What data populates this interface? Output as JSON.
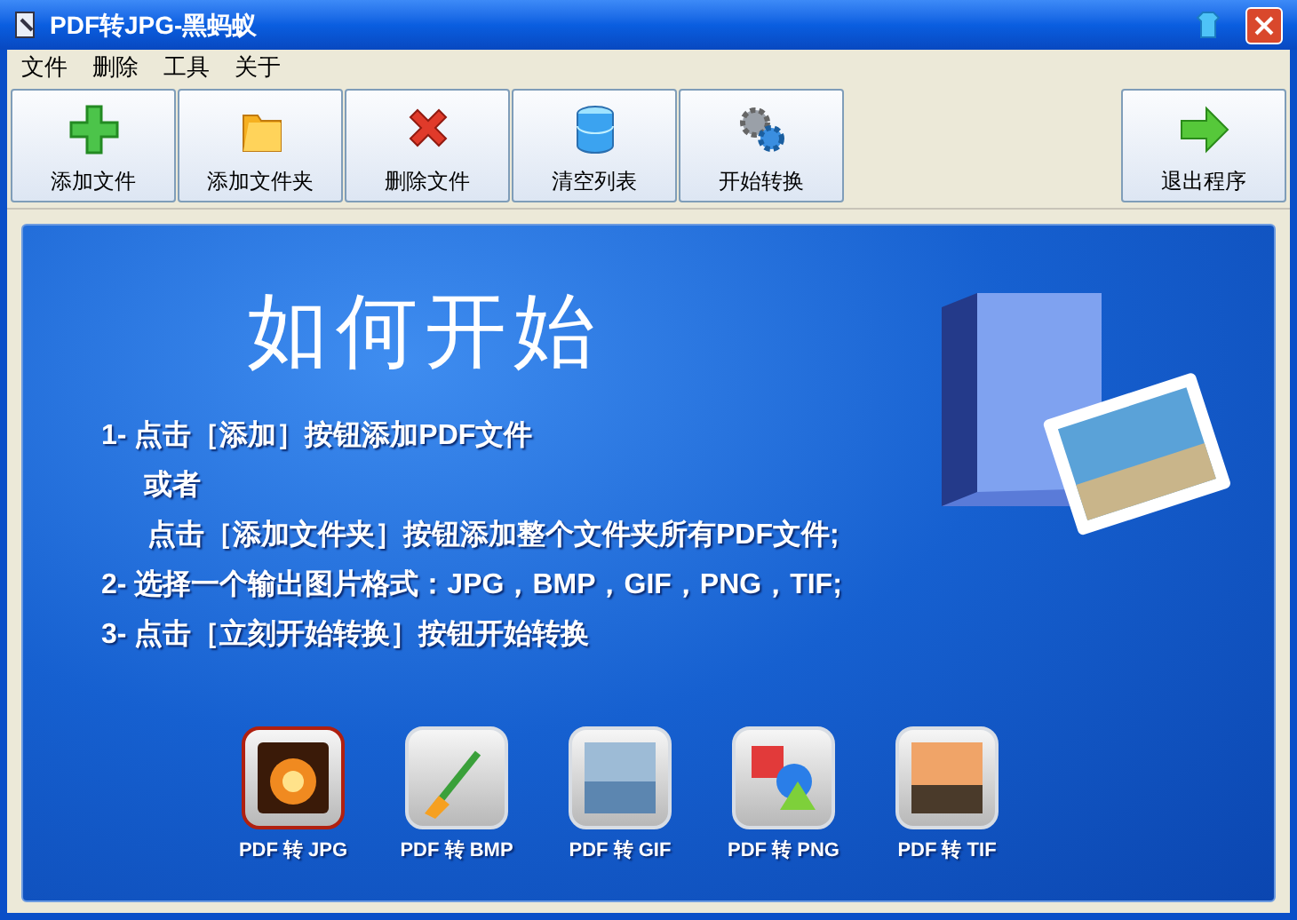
{
  "window": {
    "title": "PDF转JPG-黑蚂蚁"
  },
  "menu": [
    "文件",
    "删除",
    "工具",
    "关于"
  ],
  "toolbar": [
    {
      "kind": "add",
      "label": "添加文件"
    },
    {
      "kind": "folder",
      "label": "添加文件夹"
    },
    {
      "kind": "delete",
      "label": "删除文件"
    },
    {
      "kind": "clear",
      "label": "清空列表"
    },
    {
      "kind": "convert",
      "label": "开始转换"
    },
    {
      "kind": "exit",
      "label": "退出程序"
    }
  ],
  "heading": "如何开始",
  "instructions": [
    {
      "kind": "step",
      "text": "1- 点击［添加］按钮添加PDF文件"
    },
    {
      "kind": "sub",
      "text": "或者"
    },
    {
      "kind": "sub2",
      "text": "点击［添加文件夹］按钮添加整个文件夹所有PDF文件;"
    },
    {
      "kind": "step",
      "text": "2- 选择一个输出图片格式：JPG，BMP，GIF，PNG，TIF;"
    },
    {
      "kind": "step",
      "text": "3- 点击［立刻开始转换］按钮开始转换"
    }
  ],
  "formats": [
    {
      "kind": "jpg",
      "label": "PDF 转 JPG",
      "selected": true
    },
    {
      "kind": "bmp",
      "label": "PDF 转 BMP",
      "selected": false
    },
    {
      "kind": "gif",
      "label": "PDF 转 GIF",
      "selected": false
    },
    {
      "kind": "png",
      "label": "PDF 转 PNG",
      "selected": false
    },
    {
      "kind": "tif",
      "label": "PDF 转 TIF",
      "selected": false
    }
  ]
}
